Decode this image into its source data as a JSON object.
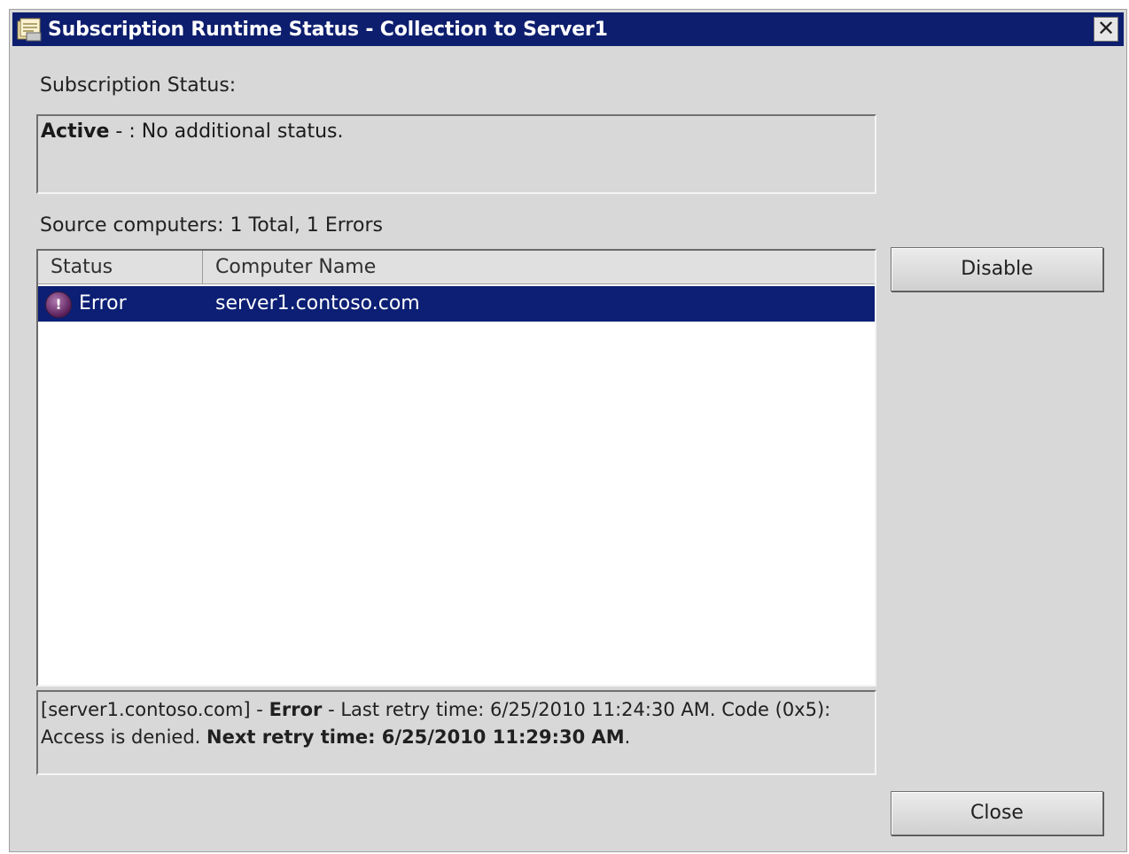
{
  "window": {
    "title": "Subscription Runtime Status - Collection to Server1",
    "close_glyph": "✕"
  },
  "subscription_status": {
    "label": "Subscription Status:",
    "state": "Active",
    "separator": " - : ",
    "message": "No additional status."
  },
  "source_computers": {
    "summary": "Source computers: 1 Total, 1 Errors",
    "columns": [
      "Status",
      "Computer Name"
    ],
    "rows": [
      {
        "icon": "error-icon",
        "status": "Error",
        "computer_name": "server1.contoso.com",
        "selected": true
      }
    ]
  },
  "detail": {
    "prefix": "[server1.contoso.com] - ",
    "status": "Error",
    "message": " - Last retry time: 6/25/2010 11:24:30 AM. Code (0x5): Access is denied. ",
    "next_retry": "Next retry time: 6/25/2010 11:29:30 AM",
    "suffix": "."
  },
  "buttons": {
    "disable": "Disable",
    "close": "Close"
  },
  "colors": {
    "titlebar": "#0d1e6e",
    "selection": "#0c1f74",
    "window_bg": "#d8d8d8"
  }
}
